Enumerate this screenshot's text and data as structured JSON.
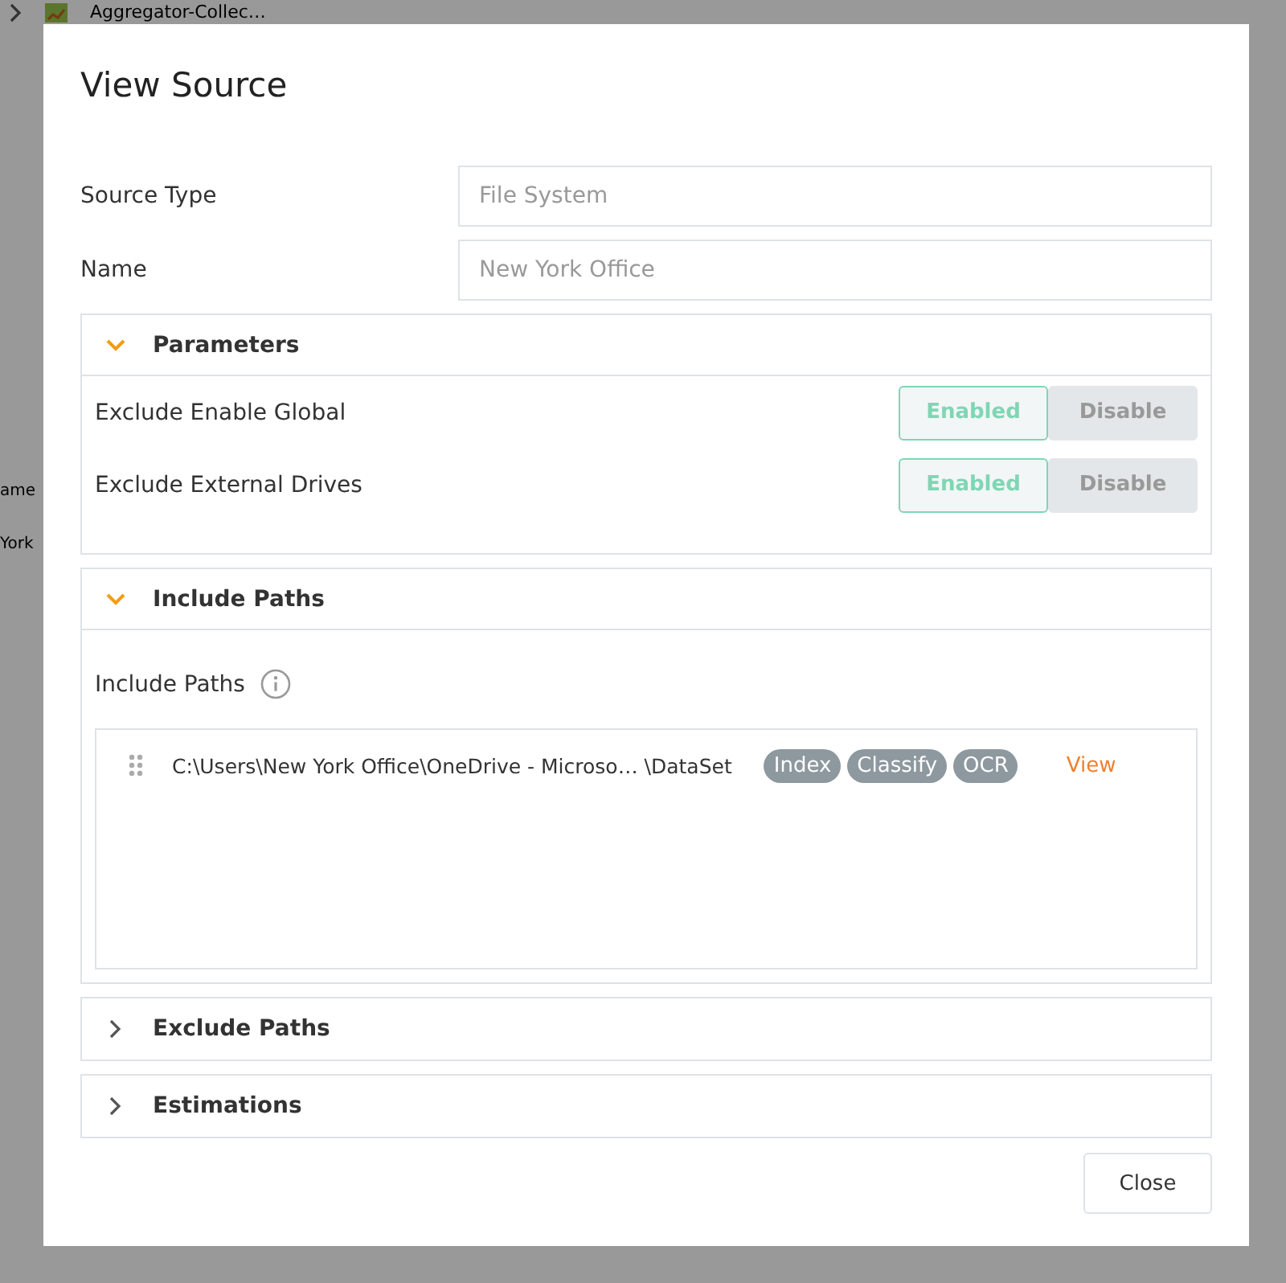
{
  "background": {
    "breadcrumb": "Aggregator-Collec…",
    "fragments": [
      "ame",
      "York"
    ]
  },
  "dialog": {
    "title": "View Source",
    "fields": [
      {
        "label": "Source Type",
        "value": "File System"
      },
      {
        "label": "Name",
        "value": "New York Office"
      }
    ],
    "sections": [
      {
        "title": "Parameters",
        "expanded": true,
        "kind": "toggles",
        "rows": [
          {
            "label": "Exclude Enable Global",
            "options": [
              {
                "label": "Enabled",
                "selected": true
              },
              {
                "label": "Disable",
                "selected": false
              }
            ]
          },
          {
            "label": "Exclude External Drives",
            "options": [
              {
                "label": "Enabled",
                "selected": true
              },
              {
                "label": "Disable",
                "selected": false
              }
            ]
          }
        ]
      },
      {
        "title": "Include Paths",
        "expanded": true,
        "kind": "paths",
        "label": "Include Paths",
        "paths": [
          {
            "path": "C:\\Users\\New York Office\\OneDrive - Microso… \\DataSet",
            "tags": [
              "Index",
              "Classify",
              "OCR"
            ],
            "action": "View"
          }
        ]
      },
      {
        "title": "Exclude Paths",
        "expanded": false
      },
      {
        "title": "Estimations",
        "expanded": false
      }
    ],
    "buttons": [
      "Close"
    ]
  }
}
